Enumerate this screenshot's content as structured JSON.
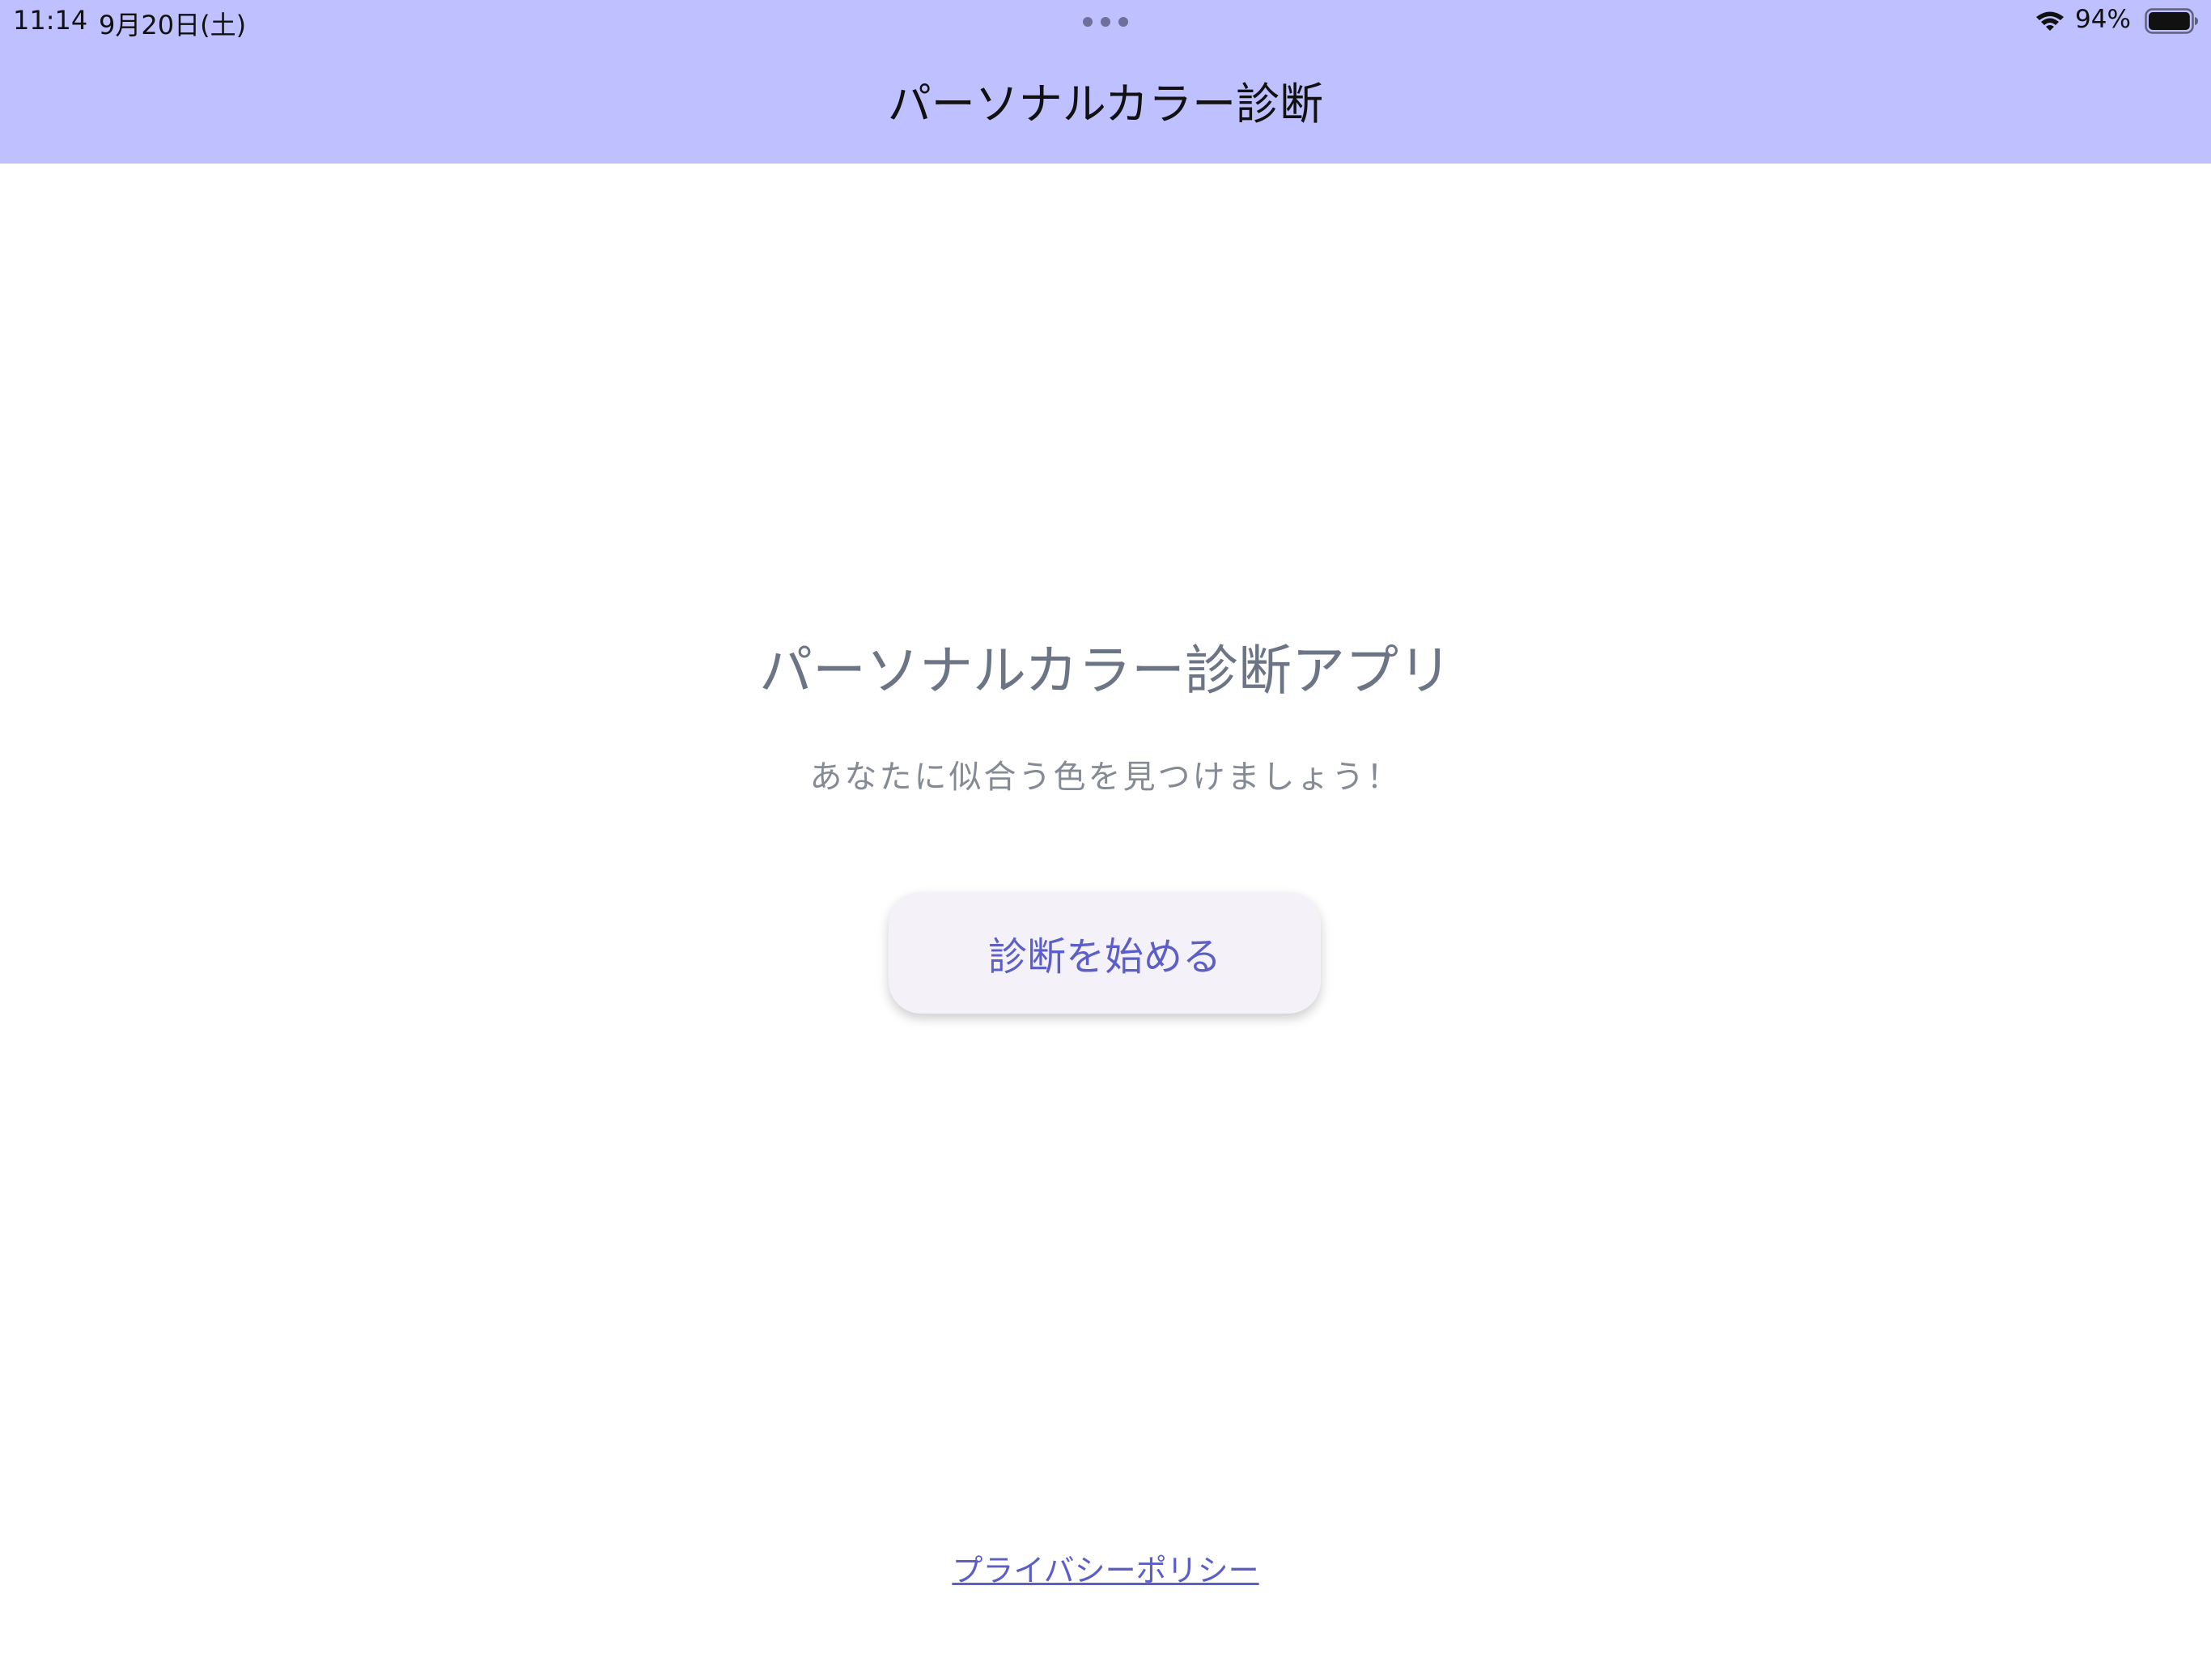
{
  "status_bar": {
    "time": "11:14",
    "date": "9月20日(土)",
    "battery_percent": "94%",
    "battery_level": 0.94
  },
  "nav": {
    "title": "パーソナルカラー診断"
  },
  "main": {
    "title": "パーソナルカラー診断アプリ",
    "subtitle": "あなたに似合う色を見つけましょう！",
    "start_button_label": "診断を始める"
  },
  "footer": {
    "privacy_link_label": "プライバシーポリシー"
  },
  "colors": {
    "header_bg": "#bfc0ff",
    "accent": "#5b5fc7",
    "button_bg": "#f4f1f9",
    "title_text": "#6b7585",
    "subtitle_text": "#858b94"
  }
}
